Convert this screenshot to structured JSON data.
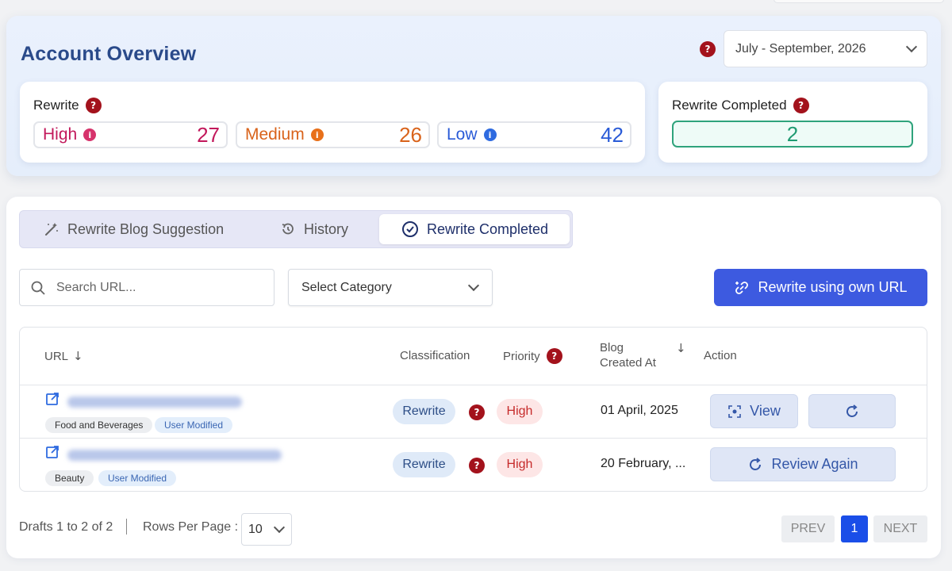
{
  "overview": {
    "title": "Account Overview",
    "help_icon": "question-badge-icon",
    "date_range": "July - September, 2026",
    "rewrite_card": {
      "label": "Rewrite",
      "stats": [
        {
          "label": "High",
          "value": "27",
          "color": "#c2185b"
        },
        {
          "label": "Medium",
          "value": "26",
          "color": "#d9631b"
        },
        {
          "label": "Low",
          "value": "42",
          "color": "#2a5bd7"
        }
      ]
    },
    "completed_card": {
      "label": "Rewrite Completed",
      "value": "2",
      "color": "#1f9b72"
    }
  },
  "tabs": [
    {
      "label": "Rewrite Blog Suggestion",
      "icon": "magic-wand-icon"
    },
    {
      "label": "History",
      "icon": "history-clock-icon"
    },
    {
      "label": "Rewrite Completed",
      "icon": "check-circle-icon",
      "active": true
    }
  ],
  "toolbar": {
    "search_placeholder": "Search URL...",
    "category_placeholder": "Select Category",
    "own_url_button": "Rewrite using own URL",
    "accent": "#3d5ae0"
  },
  "table": {
    "headers": {
      "url": "URL",
      "classification": "Classification",
      "priority": "Priority",
      "created_line1": "Blog",
      "created_line2": "Created At",
      "action": "Action"
    },
    "rows": [
      {
        "category": "Food and Beverages",
        "modified": "User Modified",
        "classification": "Rewrite",
        "priority": "High",
        "created": "01 April, 2025",
        "actions": {
          "view": "View"
        }
      },
      {
        "category": "Beauty",
        "modified": "User Modified",
        "classification": "Rewrite",
        "priority": "High",
        "created": "20 February, ...",
        "actions": {
          "review": "Review Again"
        }
      }
    ]
  },
  "footer": {
    "summary": "Drafts 1 to 2 of 2",
    "rows_per_page_label": "Rows Per Page :",
    "rows_per_page": "10",
    "prev": "PREV",
    "page": "1",
    "next": "NEXT"
  }
}
